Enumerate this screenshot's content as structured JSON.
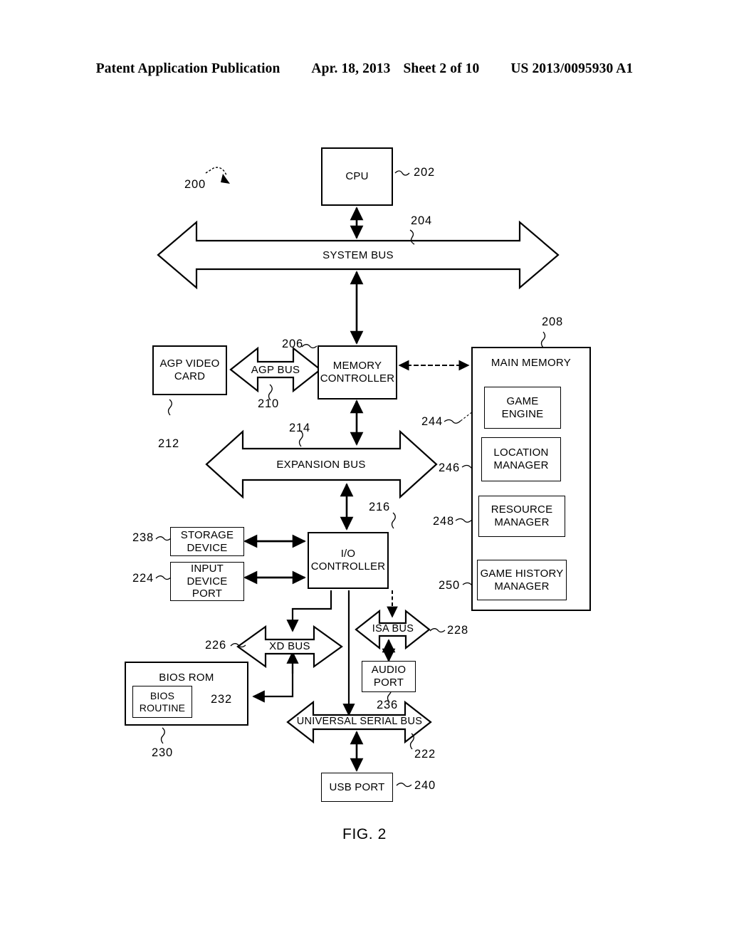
{
  "header": {
    "publication": "Patent Application Publication",
    "date": "Apr. 18, 2013",
    "sheet": "Sheet 2 of 10",
    "patent_number": "US 2013/0095930 A1"
  },
  "figure": {
    "caption": "FIG. 2",
    "system_ref": "200"
  },
  "blocks": {
    "cpu": {
      "label": "CPU",
      "ref": "202"
    },
    "memory_controller": {
      "label": "MEMORY\nCONTROLLER",
      "line1": "MEMORY",
      "line2": "CONTROLLER",
      "ref": "206"
    },
    "agp_video_card": {
      "line1": "AGP VIDEO",
      "line2": "CARD",
      "ref": "212"
    },
    "main_memory": {
      "label": "MAIN MEMORY",
      "ref": "208"
    },
    "game_engine": {
      "line1": "GAME",
      "line2": "ENGINE",
      "ref": "244"
    },
    "location_manager": {
      "line1": "LOCATION",
      "line2": "MANAGER",
      "ref": "246"
    },
    "resource_manager": {
      "line1": "RESOURCE",
      "line2": "MANAGER",
      "ref": "248"
    },
    "game_history_manager": {
      "line1": "GAME HISTORY",
      "line2": "MANAGER",
      "ref": "250"
    },
    "io_controller": {
      "line1": "I/O",
      "line2": "CONTROLLER",
      "ref": "216"
    },
    "storage_device": {
      "line1": "STORAGE",
      "line2": "DEVICE",
      "ref": "238"
    },
    "input_device_port": {
      "line1": "INPUT",
      "line2": "DEVICE",
      "line3": "PORT",
      "ref": "224"
    },
    "bios_rom": {
      "label": "BIOS ROM",
      "ref": "230"
    },
    "bios_routine": {
      "line1": "BIOS",
      "line2": "ROUTINE",
      "ref": "232"
    },
    "audio_port": {
      "line1": "AUDIO",
      "line2": "PORT",
      "ref": "236"
    },
    "usb_port": {
      "label": "USB PORT",
      "ref": "240"
    }
  },
  "buses": {
    "system_bus": {
      "label": "SYSTEM BUS",
      "ref": "204"
    },
    "agp_bus": {
      "label": "AGP BUS",
      "ref": "210"
    },
    "expansion_bus": {
      "label": "EXPANSION BUS",
      "ref": "214"
    },
    "xd_bus": {
      "label": "XD BUS",
      "ref": "226"
    },
    "isa_bus": {
      "label": "ISA BUS",
      "ref": "228"
    },
    "universal_serial_bus": {
      "label": "UNIVERSAL SERIAL  BUS",
      "ref": "222"
    }
  },
  "colors": {
    "ink": "#000000",
    "paper": "#ffffff"
  }
}
